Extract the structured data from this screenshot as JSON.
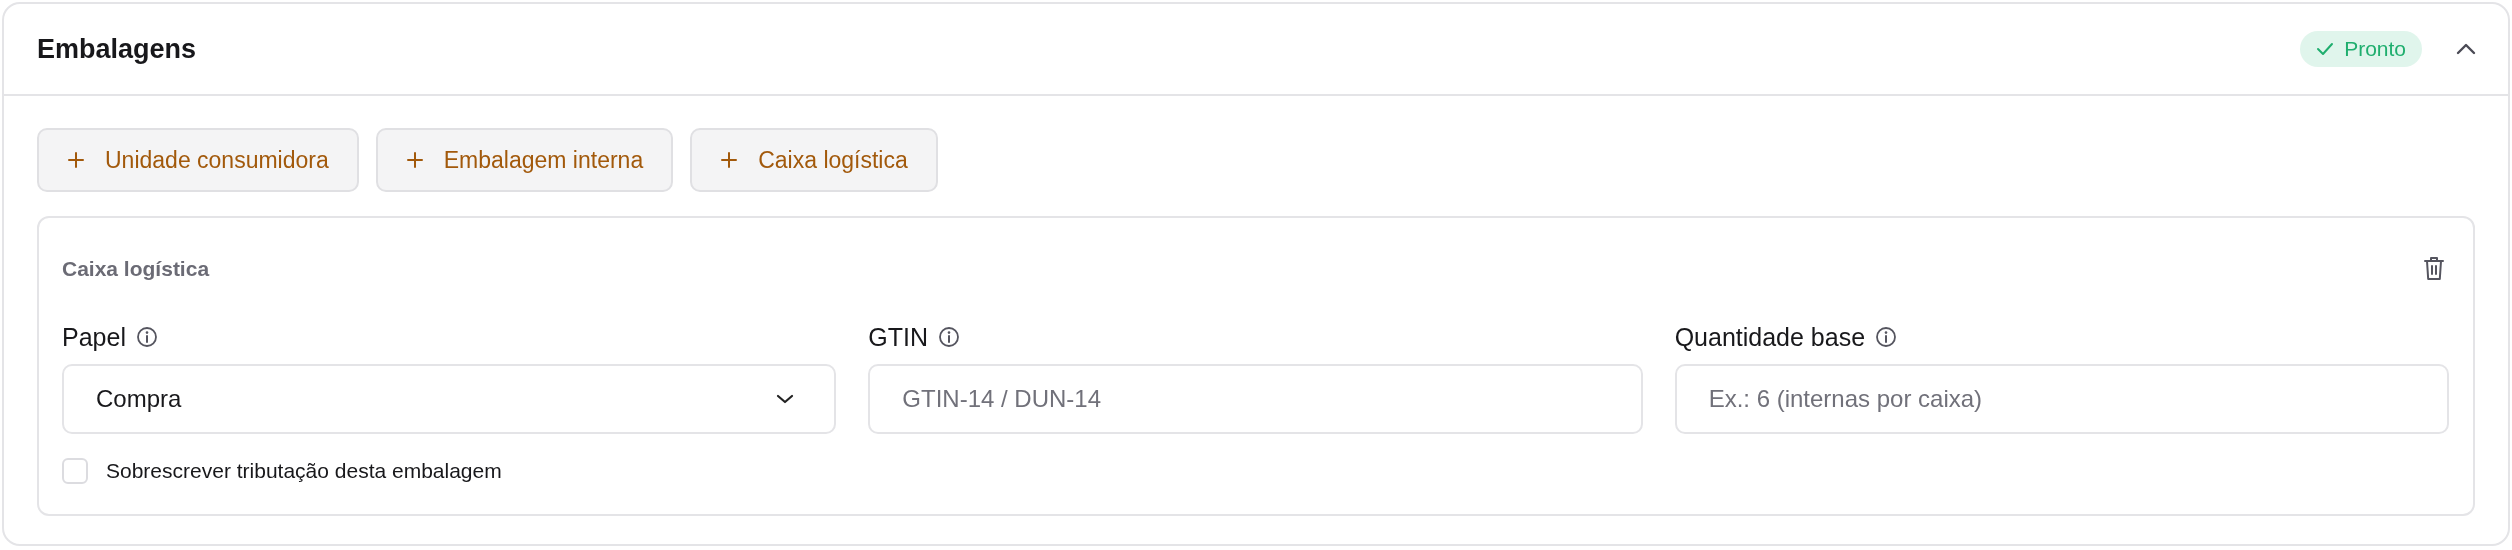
{
  "section": {
    "title": "Embalagens",
    "status": {
      "label": "Pronto",
      "kind": "ready"
    },
    "expanded": true
  },
  "add_buttons": [
    {
      "label": "Unidade consumidora"
    },
    {
      "label": "Embalagem interna"
    },
    {
      "label": "Caixa logística"
    }
  ],
  "packaging": {
    "title": "Caixa logística",
    "fields": [
      {
        "kind": "select",
        "label": "Papel",
        "value": "Compra"
      },
      {
        "kind": "text",
        "label": "GTIN",
        "placeholder": "GTIN-14 / DUN-14"
      },
      {
        "kind": "text",
        "label": "Quantidade base",
        "placeholder": "Ex.: 6 (internas por caixa)"
      }
    ],
    "override": {
      "label": "Sobrescrever tributação desta embalagem",
      "checked": false
    }
  }
}
